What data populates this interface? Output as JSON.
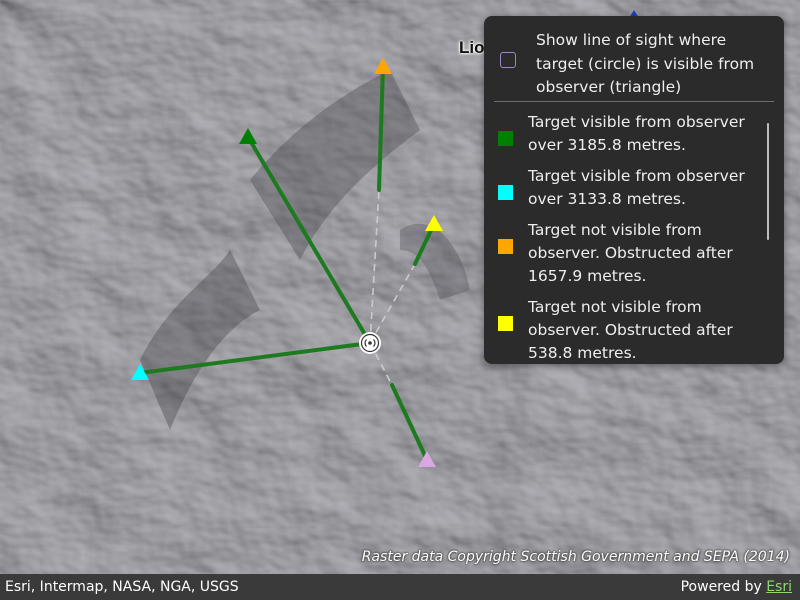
{
  "map": {
    "place_label": "Lio",
    "copyright": "Raster data Copyright Scottish Government and SEPA (2014)"
  },
  "panel": {
    "toggle": {
      "label": "Show line of sight where target (circle) is visible from observer (triangle)",
      "checked": false
    },
    "legend": [
      {
        "color": "#008000",
        "text": "Target visible from observer over 3185.8 metres."
      },
      {
        "color": "#00ffff",
        "text": "Target visible from observer over 3133.8 metres."
      },
      {
        "color": "#ffa500",
        "text": "Target not visible from observer. Obstructed after 1657.9 metres."
      },
      {
        "color": "#ffff00",
        "text": "Target not visible from observer. Obstructed after 538.8 metres."
      }
    ]
  },
  "attribution": {
    "sources": "Esri, Intermap, NASA, NGA, USGS",
    "powered_prefix": "Powered by ",
    "powered_link": "Esri"
  },
  "colors": {
    "visible_line": "#1e7a1e",
    "obstructed_line": "#cccccc",
    "observer_stroke": "#ffffff"
  }
}
